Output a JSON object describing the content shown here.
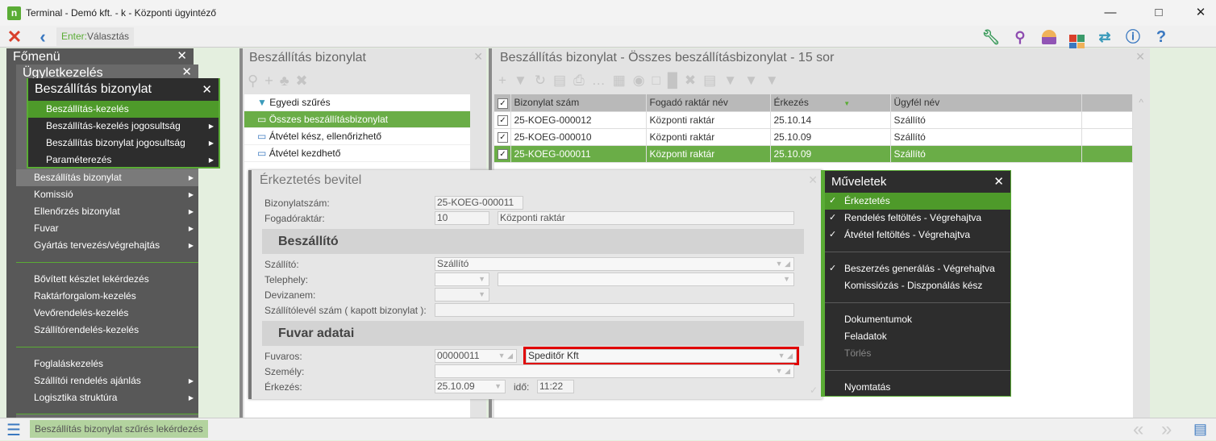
{
  "window": {
    "title": "Terminal - Demó kft. - k - Központi ügyintéző",
    "logo": "n"
  },
  "toolbar": {
    "hint_key": "Enter:",
    "hint_text": "Választás"
  },
  "main_menu": {
    "title": "Főmenü"
  },
  "business_menu": {
    "title": "Ügyletkezelés",
    "items": [
      {
        "label": "Beszállítás bizonylat",
        "submenu": true
      },
      {
        "label": "Komissió",
        "submenu": true
      },
      {
        "label": "Ellenőrzés bizonylat",
        "submenu": true
      },
      {
        "label": "Fuvar",
        "submenu": true
      },
      {
        "label": "Gyártás tervezés/végrehajtás",
        "submenu": true
      },
      {
        "label": "Bővített készlet lekérdezés"
      },
      {
        "label": "Raktárforgalom-kezelés"
      },
      {
        "label": "Vevőrendelés-kezelés"
      },
      {
        "label": "Szállítórendelés-kezelés"
      },
      {
        "label": "Foglaláskezelés"
      },
      {
        "label": "Szállítói rendelés ajánlás",
        "submenu": true
      },
      {
        "label": "Logisztika struktúra",
        "submenu": true
      }
    ]
  },
  "submenu": {
    "title": "Beszállítás bizonylat",
    "items": [
      {
        "label": "Beszállítás-kezelés"
      },
      {
        "label": "Beszállítás-kezelés jogosultság",
        "submenu": true
      },
      {
        "label": "Beszállítás bizonylat jogosultság",
        "submenu": true
      },
      {
        "label": "Paraméterezés",
        "submenu": true
      }
    ]
  },
  "filter_panel": {
    "title": "Beszállítás bizonylat",
    "items": [
      "Egyedi szűrés",
      "Összes beszállításbizonylat",
      "Átvétel kész, ellenőrizhető",
      "Átvétel kezdhető"
    ]
  },
  "grid_panel": {
    "title": "Beszállítás bizonylat - Összes beszállításbizonylat - 15 sor",
    "columns": [
      "Bizonylat szám",
      "Fogadó raktár név",
      "Érkezés",
      "Ügyfél név"
    ],
    "rows": [
      [
        "25-KOEG-000012",
        "Központi raktár",
        "25.10.14",
        "Szállító"
      ],
      [
        "25-KOEG-000010",
        "Központi raktár",
        "25.10.09",
        "Szállító"
      ],
      [
        "25-KOEG-000011",
        "Központi raktár",
        "25.10.09",
        "Szállító"
      ]
    ]
  },
  "dialog": {
    "title": "Érkeztetés bevitel",
    "doc_no_label": "Bizonylatszám:",
    "doc_no": "25-KOEG-000011",
    "warehouse_label": "Fogadóraktár:",
    "warehouse_code": "10",
    "warehouse_name": "Központi raktár",
    "supplier_section": "Beszállító",
    "supplier_label": "Szállító:",
    "supplier": "Szállító",
    "site_label": "Telephely:",
    "currency_label": "Devizanem:",
    "delivery_note_label": "Szállítólevél szám ( kapott bizonylat ):",
    "transport_section": "Fuvar adatai",
    "carrier_label": "Fuvaros:",
    "carrier_code": "00000011",
    "carrier_name": "Speditőr Kft",
    "person_label": "Személy:",
    "arrival_label": "Érkezés:",
    "arrival_date": "25.10.09",
    "time_label": "idő:",
    "time": "11:22"
  },
  "operations": {
    "title": "Műveletek",
    "items": [
      {
        "label": "Érkeztetés",
        "checked": true
      },
      {
        "label": "Rendelés feltöltés - Végrehajtva",
        "checked": true
      },
      {
        "label": "Átvétel feltöltés - Végrehajtva",
        "checked": true
      },
      {
        "label": "Beszerzés generálás - Végrehajtva",
        "checked": true
      },
      {
        "label": "Komissiózás - Diszponálás kész"
      },
      {
        "label": "Dokumentumok"
      },
      {
        "label": "Feladatok"
      },
      {
        "label": "Törlés",
        "disabled": true
      },
      {
        "label": "Nyomtatás"
      }
    ]
  },
  "statusbar": {
    "text": "Beszállítás bizonylat szűrés lekérdezés"
  },
  "colors": {
    "accent": "#5aac35",
    "selected_row": "#6aad47",
    "highlight_border": "#e00000"
  }
}
